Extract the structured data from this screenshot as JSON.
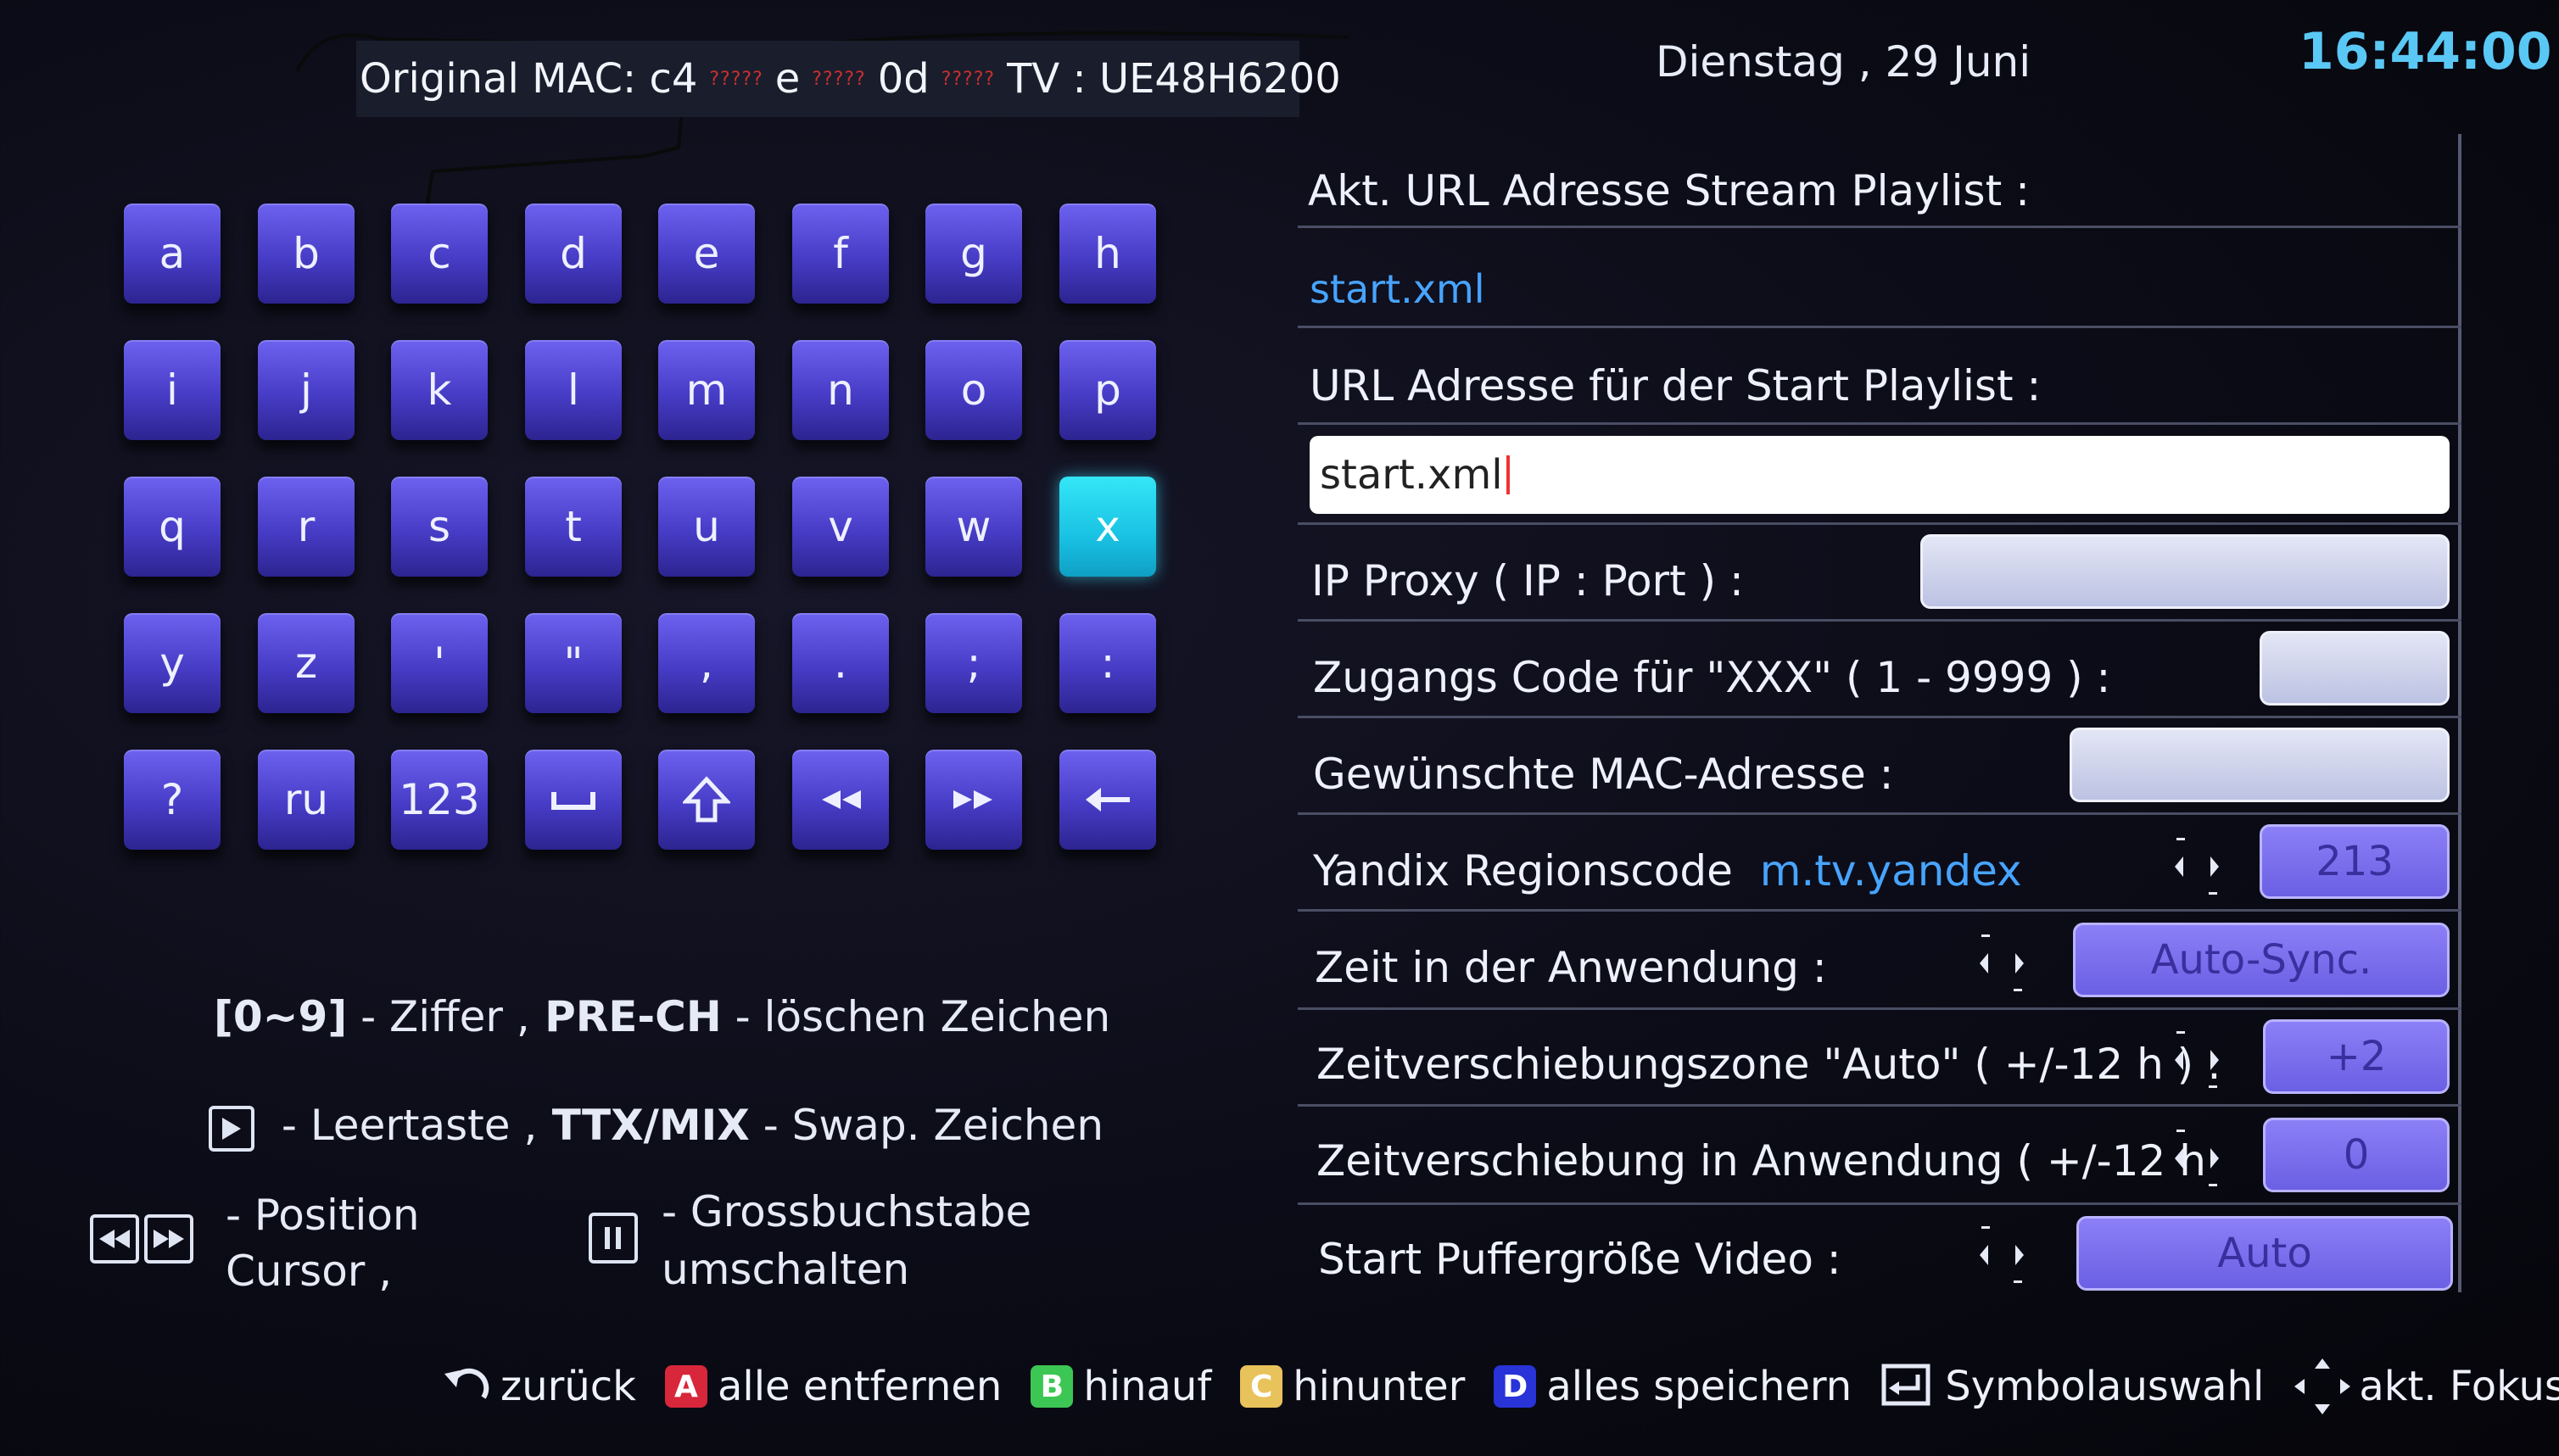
{
  "header": {
    "mac_prefix": "Original MAC: c4",
    "mac_blur": "?????",
    "mac_part2": "e",
    "mac_part3": "0d",
    "tv_label": "TV : UE48H6200",
    "date": "Dienstag ,  29  Juni",
    "time": "16:44:00"
  },
  "keyboard": {
    "rows": [
      [
        "a",
        "b",
        "c",
        "d",
        "e",
        "f",
        "g",
        "h"
      ],
      [
        "i",
        "j",
        "k",
        "l",
        "m",
        "n",
        "o",
        "p"
      ],
      [
        "q",
        "r",
        "s",
        "t",
        "u",
        "v",
        "w",
        "x"
      ],
      [
        "y",
        "z",
        "'",
        "\"",
        ",",
        ".",
        ";",
        ":"
      ],
      [
        "?",
        "ru",
        "123",
        "space-icon",
        "shift-icon",
        "rewind-icon",
        "fast-forward-icon",
        "backspace-icon"
      ]
    ],
    "selected": "x"
  },
  "help": {
    "line1_key": "[0~9]",
    "line1_a": " - Ziffer ,",
    "line1_key2": " PRE-CH",
    "line1_b": " - löschen Zeichen",
    "line2_a": " - Leertaste ,",
    "line2_key": " TTX/MIX",
    "line2_b": " - Swap. Zeichen",
    "line3_a": "- Position",
    "line3_b": "Cursor ,",
    "line4_a": "- Grossbuchstabe",
    "line4_b": "umschalten"
  },
  "settings": {
    "stream_label": "Akt. URL  Adresse  Stream  Playlist :",
    "stream_value": "start.xml",
    "start_label": "URL  Adresse  für der Start Playlist :",
    "start_input": "start.xml",
    "proxy_label": "IP  Proxy ( IP : Port ) :",
    "access_label": "Zugangs Code für \"XXX\" ( 1 - 9999 ) :",
    "mac_label": "Gewünschte  MAC-Adresse :",
    "yandex_label": "Yandix  Regionscode",
    "yandex_link": "m.tv.yandex",
    "yandex_value": "213",
    "time_label": "Zeit  in der  Anwendung :",
    "time_value": "Auto-Sync.",
    "zone_label": "Zeitverschiebungszone \"Auto\" ( +/-12 h ) :",
    "zone_value": "+2",
    "shift_label": "Zeitverschiebung  in  Anwendung ( +/-12 h",
    "shift_value": "0",
    "buffer_label": "Start  Puffergröße Video :",
    "buffer_value": "Auto"
  },
  "footer": {
    "back": "zurück",
    "a_key": "A",
    "a_label": "alle entfernen",
    "b_key": "B",
    "b_label": "hinauf",
    "c_key": "C",
    "c_label": "hinunter",
    "d_key": "D",
    "d_label": "alles speichern",
    "symbol": "Symbolauswahl",
    "focus": "akt. Fokus"
  },
  "colors": {
    "accent_clock": "#5ac8f5",
    "key": "#4f44d6",
    "key_selected": "#22cdea",
    "red": "#d8263b",
    "green": "#3cc653",
    "yellow": "#e8c25a",
    "blue": "#2833d8"
  }
}
